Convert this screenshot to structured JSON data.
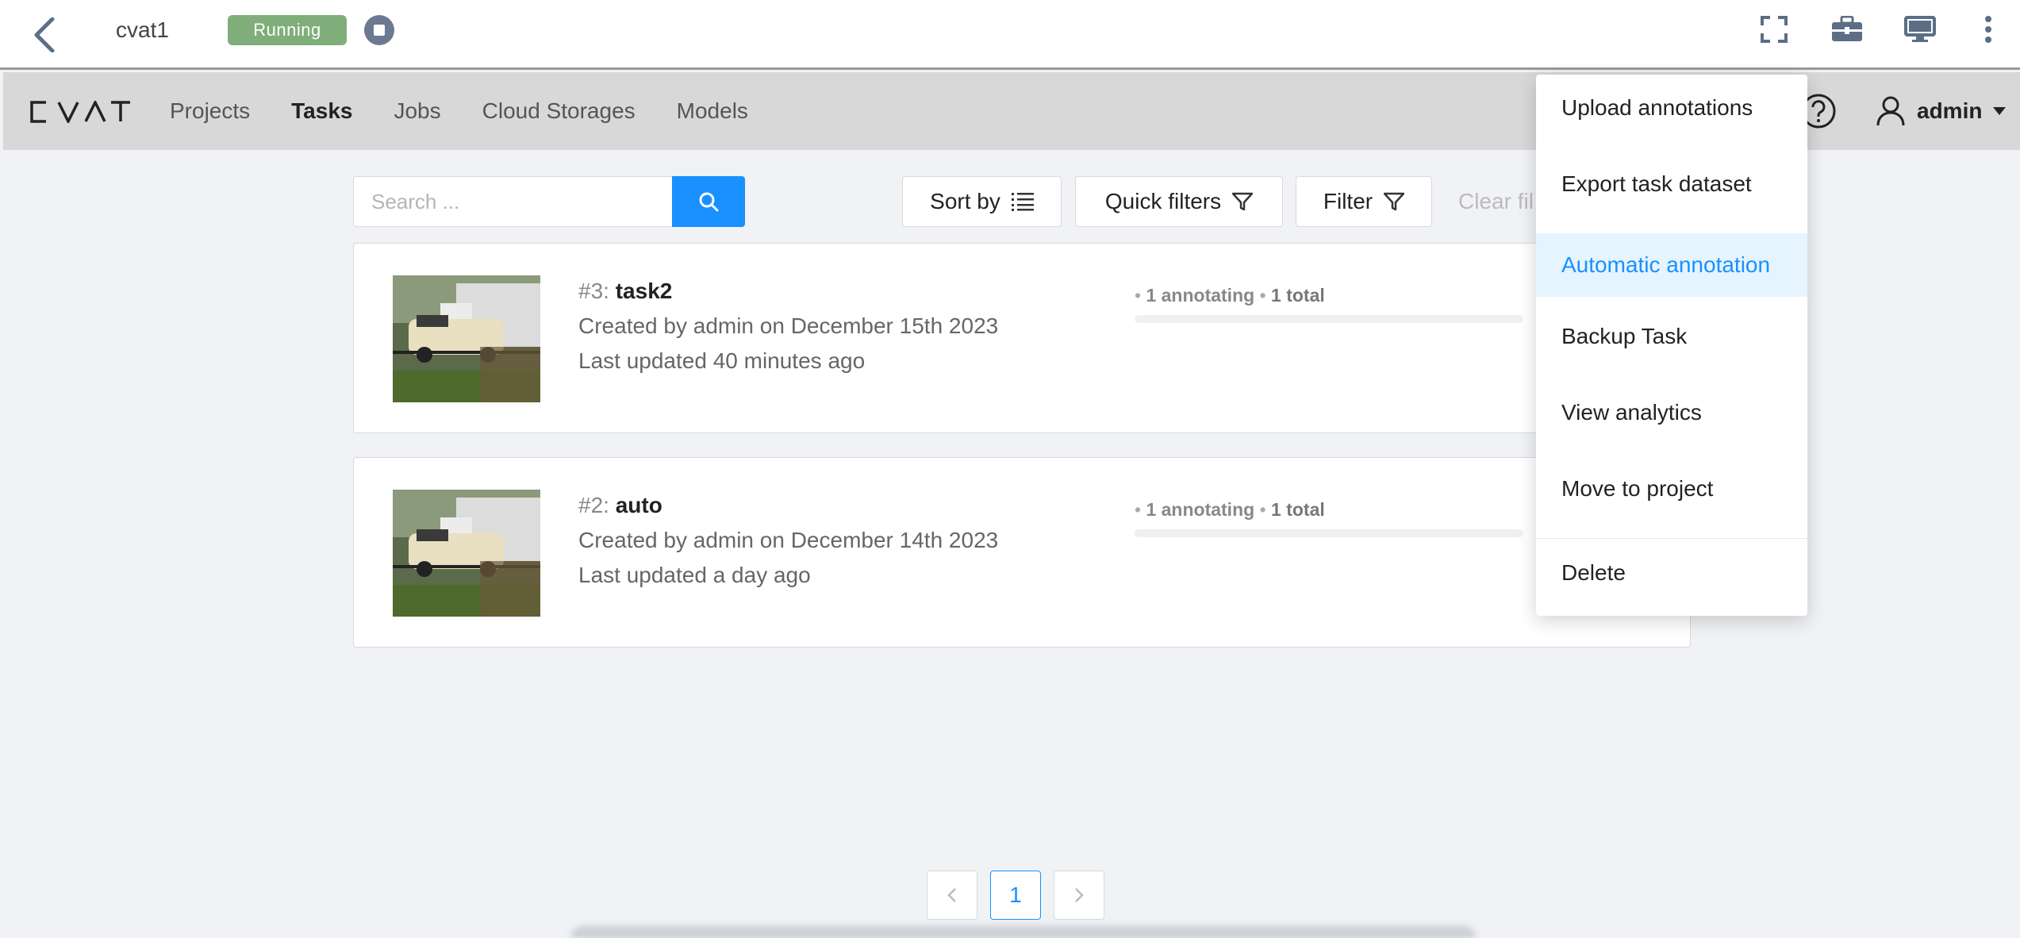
{
  "outer_bar": {
    "vm_name": "cvat1",
    "status": "Running",
    "icons": [
      "fullscreen-icon",
      "toolbox-icon",
      "monitor-icon",
      "more-vertical-icon"
    ]
  },
  "header": {
    "logo": "CVAT",
    "nav": [
      "Projects",
      "Tasks",
      "Jobs",
      "Cloud Storages",
      "Models"
    ],
    "active_nav": "Tasks",
    "user": "admin"
  },
  "toolbar": {
    "search_placeholder": "Search ...",
    "sort_label": "Sort by",
    "quick_filters_label": "Quick filters",
    "filter_label": "Filter",
    "clear_filters_label": "Clear fil"
  },
  "tasks": [
    {
      "id": "#3:",
      "name": "task2",
      "created": "Created by admin on December 15th 2023",
      "updated": "Last updated 40 minutes ago",
      "annotating": "1 annotating",
      "total": "1 total"
    },
    {
      "id": "#2:",
      "name": "auto",
      "created": "Created by admin on December 14th 2023",
      "updated": "Last updated a day ago",
      "annotating": "1 annotating",
      "total": "1 total"
    }
  ],
  "pagination": {
    "current": "1"
  },
  "menu": {
    "items": [
      "Upload annotations",
      "Export task dataset",
      "Automatic annotation",
      "Backup Task",
      "View analytics",
      "Move to project"
    ],
    "danger": "Delete",
    "selected": "Automatic annotation"
  },
  "colors": {
    "primary": "#1890ff",
    "running": "#7fae7a",
    "header_bg": "#d8d8d8"
  }
}
